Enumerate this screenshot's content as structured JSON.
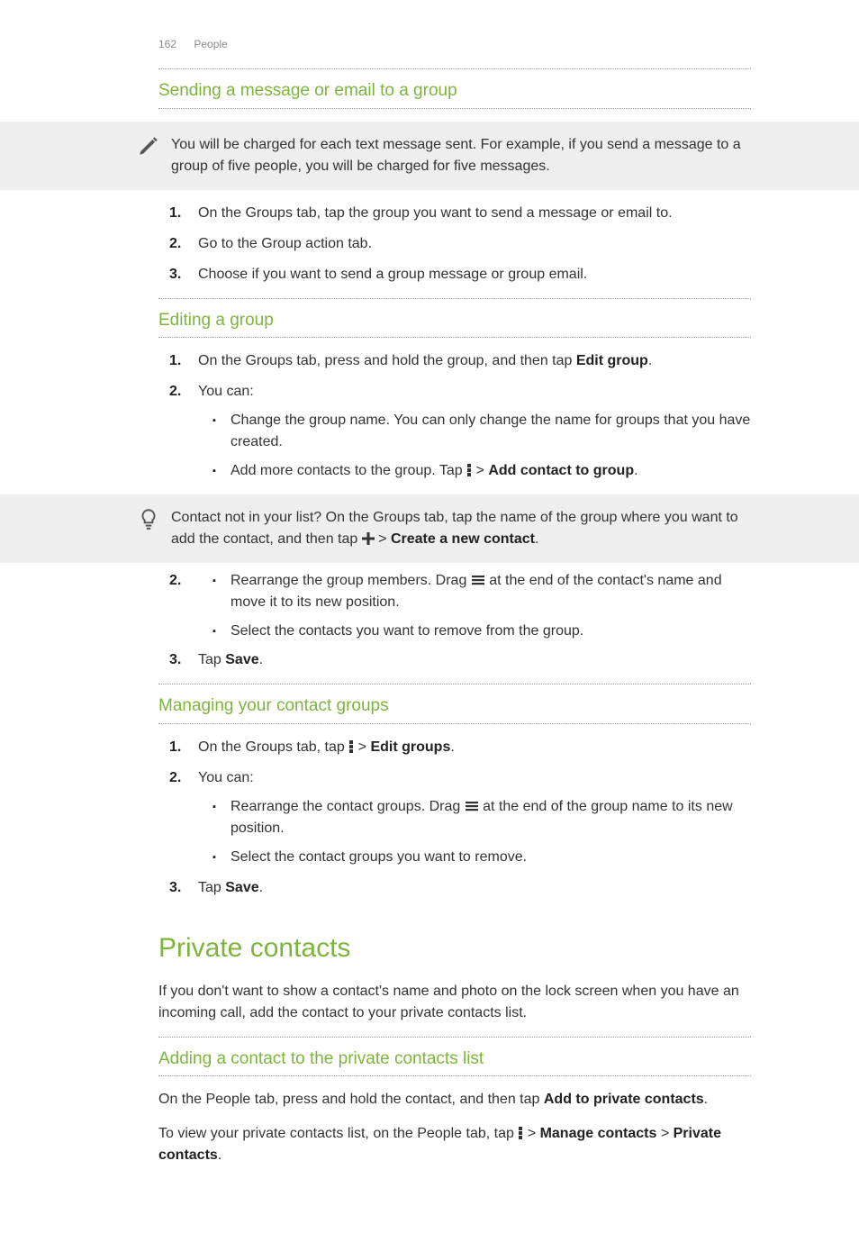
{
  "header": {
    "page_number": "162",
    "section": "People"
  },
  "s1": {
    "title": "Sending a message or email to a group",
    "note": "You will be charged for each text message sent. For example, if you send a message to a group of five people, you will be charged for five messages.",
    "step1": "On the Groups tab, tap the group you want to send a message or email to.",
    "step2": "Go to the Group action tab.",
    "step3": "Choose if you want to send a group message or group email."
  },
  "s2": {
    "title": "Editing a group",
    "step1_a": "On the Groups tab, press and hold the group, and then tap ",
    "step1_b": "Edit group",
    "step1_c": ".",
    "step2": "You can:",
    "b1": "Change the group name. You can only change the name for groups that you have created.",
    "b2_a": "Add more contacts to the group. Tap ",
    "b2_b": " > ",
    "b2_c": "Add contact to group",
    "b2_d": ".",
    "tip_a": "Contact not in your list? On the Groups tab, tap the name of the group where you want to add the contact, and then tap ",
    "tip_b": " > ",
    "tip_c": "Create a new contact",
    "tip_d": ".",
    "b3_a": "Rearrange the group members. Drag ",
    "b3_b": " at the end of the contact's name and move it to its new position.",
    "b4": "Select the contacts you want to remove from the group.",
    "step3_a": "Tap ",
    "step3_b": "Save",
    "step3_c": "."
  },
  "s3": {
    "title": "Managing your contact groups",
    "step1_a": "On the Groups tab, tap ",
    "step1_b": " > ",
    "step1_c": "Edit groups",
    "step1_d": ".",
    "step2": "You can:",
    "b1_a": "Rearrange the contact groups. Drag ",
    "b1_b": " at the end of the group name to its new position.",
    "b2": "Select the contact groups you want to remove.",
    "step3_a": "Tap ",
    "step3_b": "Save",
    "step3_c": "."
  },
  "s4": {
    "title": "Private contacts",
    "intro": "If you don't want to show a contact's name and photo on the lock screen when you have an incoming call, add the contact to your private contacts list.",
    "sub_title": "Adding a contact to the private contacts list",
    "p1_a": "On the People tab, press and hold the contact, and then tap ",
    "p1_b": "Add to private contacts",
    "p1_c": ".",
    "p2_a": "To view your private contacts list, on the People tab, tap ",
    "p2_b": " > ",
    "p2_c": "Manage contacts",
    "p2_d": " > ",
    "p2_e": "Private contacts",
    "p2_f": "."
  }
}
